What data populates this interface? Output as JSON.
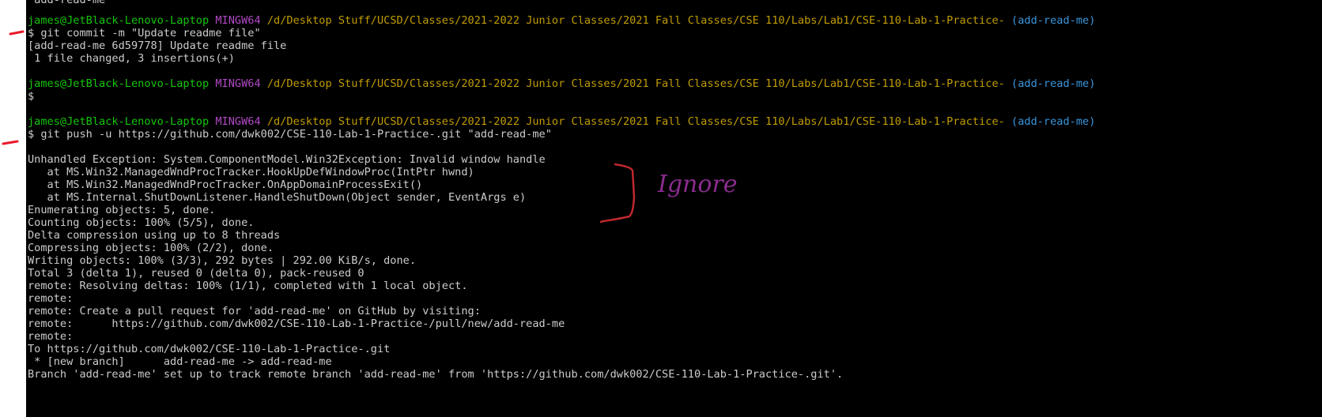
{
  "prompts": [
    {
      "user": "james@JetBlack-Lenovo-Laptop",
      "env": "MINGW64",
      "path": "/d/Desktop Stuff/UCSD/Classes/2021-2022 Junior Classes/2021 Fall Classes/CSE 110/Labs/Lab1/CSE-110-Lab-1-Practice-",
      "branch": "(add-read-me)"
    },
    {
      "user": "james@JetBlack-Lenovo-Laptop",
      "env": "MINGW64",
      "path": "/d/Desktop Stuff/UCSD/Classes/2021-2022 Junior Classes/2021 Fall Classes/CSE 110/Labs/Lab1/CSE-110-Lab-1-Practice-",
      "branch": "(add-read-me)"
    },
    {
      "user": "james@JetBlack-Lenovo-Laptop",
      "env": "MINGW64",
      "path": "/d/Desktop Stuff/UCSD/Classes/2021-2022 Junior Classes/2021 Fall Classes/CSE 110/Labs/Lab1/CSE-110-Lab-1-Practice-",
      "branch": "(add-read-me)"
    }
  ],
  "lines": {
    "top_partial": "'add-read-me'",
    "cmd1": "$ git commit -m \"Update readme file\"",
    "out1a": "[add-read-me 6d59778] Update readme file",
    "out1b": " 1 file changed, 3 insertions(+)",
    "cmd2": "$",
    "cmd3": "$ git push -u https://github.com/dwk002/CSE-110-Lab-1-Practice-.git \"add-read-me\"",
    "ex1": "Unhandled Exception: System.ComponentModel.Win32Exception: Invalid window handle",
    "ex2": "   at MS.Win32.ManagedWndProcTracker.HookUpDefWindowProc(IntPtr hwnd)",
    "ex3": "   at MS.Win32.ManagedWndProcTracker.OnAppDomainProcessExit()",
    "ex4": "   at MS.Internal.ShutDownListener.HandleShutDown(Object sender, EventArgs e)",
    "o1": "Enumerating objects: 5, done.",
    "o2": "Counting objects: 100% (5/5), done.",
    "o3": "Delta compression using up to 8 threads",
    "o4": "Compressing objects: 100% (2/2), done.",
    "o5": "Writing objects: 100% (3/3), 292 bytes | 292.00 KiB/s, done.",
    "o6": "Total 3 (delta 1), reused 0 (delta 0), pack-reused 0",
    "o7": "remote: Resolving deltas: 100% (1/1), completed with 1 local object.",
    "o8": "remote:",
    "o9": "remote: Create a pull request for 'add-read-me' on GitHub by visiting:",
    "o10": "remote:      https://github.com/dwk002/CSE-110-Lab-1-Practice-/pull/new/add-read-me",
    "o11": "remote:",
    "o12": "To https://github.com/dwk002/CSE-110-Lab-1-Practice-.git",
    "o13": " * [new branch]      add-read-me -> add-read-me",
    "o14": "Branch 'add-read-me' set up to track remote branch 'add-read-me' from 'https://github.com/dwk002/CSE-110-Lab-1-Practice-.git'."
  },
  "annotation": {
    "text": "Ignore",
    "color": "#8a2c8e",
    "bracket_color": "#c0282e",
    "marker_color": "#e8192c"
  }
}
